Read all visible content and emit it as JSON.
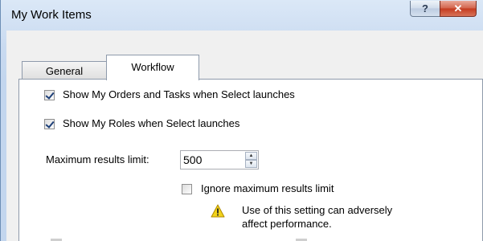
{
  "window": {
    "title": "My Work Items",
    "help_label": "?",
    "close_label": "✕"
  },
  "tabs": [
    {
      "label": "General",
      "selected": false
    },
    {
      "label": "Workflow",
      "selected": true
    }
  ],
  "workflow": {
    "show_orders_tasks": {
      "label": "Show My Orders and Tasks when Select launches",
      "checked": true
    },
    "show_roles": {
      "label": "Show My Roles when Select launches",
      "checked": true
    },
    "max_results": {
      "label": "Maximum results limit:",
      "value": "500"
    },
    "ignore_max": {
      "label": "Ignore maximum results limit",
      "checked": false
    },
    "warning": {
      "line1": "Use of this setting can adversely",
      "line2": "affect performance."
    }
  },
  "icons": {
    "warning": "warning-triangle-icon",
    "spin_up": "spin-up-icon",
    "spin_down": "spin-down-icon"
  },
  "colors": {
    "titlebar": "#c9daf0",
    "close_button": "#c43a1e",
    "warning_fill": "#f2d31b"
  }
}
